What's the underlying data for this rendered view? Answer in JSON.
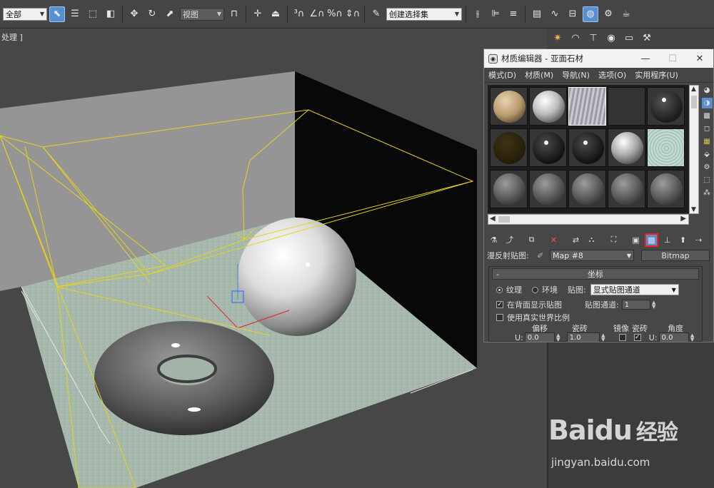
{
  "toolbar": {
    "selection_filter": "全部",
    "reference_coord": "视图",
    "named_selection": "创建选择集"
  },
  "viewport": {
    "label": "处理 ]"
  },
  "material_editor": {
    "title": "材质编辑器 - 亚面石材",
    "menu": [
      "模式(D)",
      "材质(M)",
      "导航(N)",
      "选项(O)",
      "实用程序(U)"
    ],
    "map_label": "漫反射贴图:",
    "map_name": "Map #8",
    "map_type": "Bitmap",
    "rollout_title": "坐标",
    "radio_texture": "纹理",
    "radio_environ": "环境",
    "mapping_label": "贴图:",
    "mapping_value": "显式贴图通道",
    "show_back_label": "在背面显示贴图",
    "map_channel_label": "贴图通道:",
    "map_channel_value": "1",
    "real_world_label": "使用真实世界比例",
    "col_offset": "偏移",
    "col_tiling": "瓷砖",
    "col_mirror": "镜像",
    "col_tile": "瓷砖",
    "col_angle": "角度",
    "u_label": "U:",
    "u_offset": "0.0",
    "u_tiling": "1.0",
    "u_angle": "0.0"
  },
  "watermark": {
    "brand": "Baidu",
    "brand_cn": "经验",
    "url": "jingyan.baidu.com"
  },
  "colors": {
    "highlight_red": "#e22222",
    "active_blue": "#5a8fcf",
    "light_yellow": "#e8d21c"
  }
}
